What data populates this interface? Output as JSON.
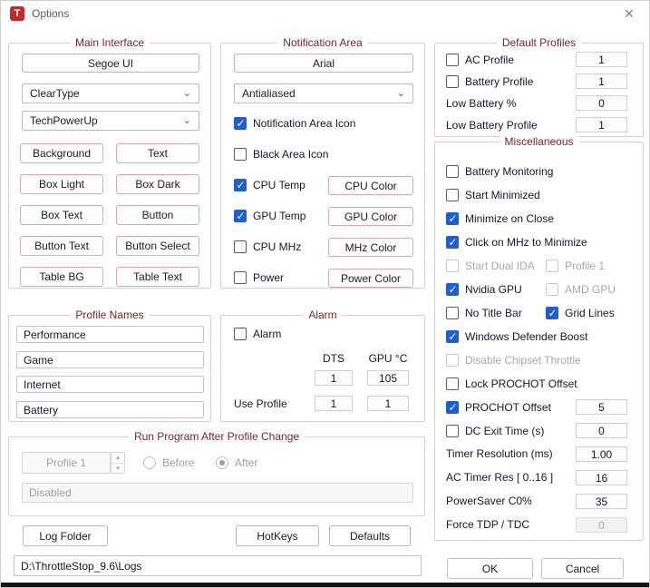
{
  "window": {
    "title": "Options",
    "app_icon_letter": "T"
  },
  "icons": {
    "close": "×",
    "chevron_down": "⌄",
    "spinner_up": "▴",
    "spinner_down": "▾"
  },
  "main_interface": {
    "title": "Main Interface",
    "font_button": "Segoe UI",
    "smoothing": "ClearType",
    "theme": "TechPowerUp",
    "color_buttons": [
      "Background",
      "Text",
      "Box Light",
      "Box Dark",
      "Box Text",
      "Button",
      "Button Text",
      "Button Select",
      "Table BG",
      "Table Text"
    ]
  },
  "notification_area": {
    "title": "Notification Area",
    "font_button": "Arial",
    "render_mode": "Antialiased",
    "icon_check": {
      "label": "Notification Area Icon",
      "checked": true
    },
    "black_check": {
      "label": "Black Area Icon",
      "checked": false
    },
    "rows": [
      {
        "label": "CPU Temp",
        "checked": true,
        "button": "CPU Color"
      },
      {
        "label": "GPU Temp",
        "checked": true,
        "button": "GPU Color"
      },
      {
        "label": "CPU MHz",
        "checked": false,
        "button": "MHz Color"
      },
      {
        "label": "Power",
        "checked": false,
        "button": "Power Color"
      }
    ]
  },
  "default_profiles": {
    "title": "Default Profiles",
    "ac": {
      "label": "AC Profile",
      "checked": false,
      "value": "1"
    },
    "battery": {
      "label": "Battery Profile",
      "checked": false,
      "value": "1"
    },
    "low_battery": {
      "label": "Low Battery %",
      "value": "0"
    },
    "low_battery_profile": {
      "label": "Low Battery Profile",
      "value": "1"
    }
  },
  "miscellaneous": {
    "title": "Miscellaneous",
    "battery_monitoring": {
      "label": "Battery Monitoring",
      "checked": false
    },
    "start_minimized": {
      "label": "Start Minimized",
      "checked": false
    },
    "minimize_on_close": {
      "label": "Minimize on Close",
      "checked": true
    },
    "click_mhz": {
      "label": "Click on MHz to Minimize",
      "checked": true
    },
    "start_dual_ida": {
      "label": "Start Dual IDA",
      "checked": false,
      "disabled": true
    },
    "profile1": {
      "label": "Profile 1",
      "checked": false,
      "disabled": true
    },
    "nvidia": {
      "label": "Nvidia GPU",
      "checked": true
    },
    "amd": {
      "label": "AMD GPU",
      "checked": false,
      "disabled": true
    },
    "no_title_bar": {
      "label": "No Title Bar",
      "checked": false
    },
    "grid_lines": {
      "label": "Grid Lines",
      "checked": true
    },
    "defender": {
      "label": "Windows Defender Boost",
      "checked": true
    },
    "chipset": {
      "label": "Disable Chipset Throttle",
      "checked": false,
      "disabled": true
    },
    "lock_prochot": {
      "label": "Lock PROCHOT Offset",
      "checked": false
    },
    "prochot_offset": {
      "label": "PROCHOT Offset",
      "checked": true,
      "value": "5"
    },
    "dc_exit": {
      "label": "DC Exit Time (s)",
      "checked": false,
      "value": "0"
    },
    "timer_res": {
      "label": "Timer Resolution (ms)",
      "value": "1.00"
    },
    "ac_timer": {
      "label": "AC Timer Res [ 0..16 ]",
      "value": "16"
    },
    "powersaver": {
      "label": "PowerSaver C0%",
      "value": "35"
    },
    "force_tdp": {
      "label": "Force TDP / TDC",
      "value": "0",
      "disabled": true
    }
  },
  "profile_names": {
    "title": "Profile Names",
    "names": [
      "Performance",
      "Game",
      "Internet",
      "Battery"
    ]
  },
  "alarm": {
    "title": "Alarm",
    "check": {
      "label": "Alarm",
      "checked": false
    },
    "dts_header": "DTS",
    "gpu_header": "GPU °C",
    "dts_value": "1",
    "gpu_value": "105",
    "use_profile_label": "Use Profile",
    "use_profile_dts": "1",
    "use_profile_gpu": "1"
  },
  "run_program": {
    "title": "Run Program After Profile Change",
    "profile_selector": "Profile 1",
    "before": {
      "label": "Before",
      "selected": false
    },
    "after": {
      "label": "After",
      "selected": true
    },
    "program_path": "Disabled"
  },
  "footer": {
    "log_folder": "Log Folder",
    "hotkeys": "HotKeys",
    "defaults": "Defaults",
    "log_path": "D:\\ThrottleStop_9.6\\Logs",
    "ok": "OK",
    "cancel": "Cancel"
  }
}
